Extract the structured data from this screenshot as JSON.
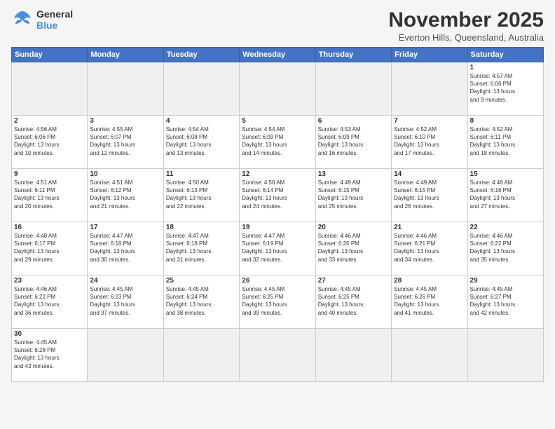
{
  "header": {
    "logo_general": "General",
    "logo_blue": "Blue",
    "month_title": "November 2025",
    "subtitle": "Everton Hills, Queensland, Australia"
  },
  "weekdays": [
    "Sunday",
    "Monday",
    "Tuesday",
    "Wednesday",
    "Thursday",
    "Friday",
    "Saturday"
  ],
  "weeks": [
    [
      {
        "day": "",
        "info": ""
      },
      {
        "day": "",
        "info": ""
      },
      {
        "day": "",
        "info": ""
      },
      {
        "day": "",
        "info": ""
      },
      {
        "day": "",
        "info": ""
      },
      {
        "day": "",
        "info": ""
      },
      {
        "day": "1",
        "info": "Sunrise: 4:57 AM\nSunset: 6:06 PM\nDaylight: 13 hours\nand 9 minutes."
      }
    ],
    [
      {
        "day": "2",
        "info": "Sunrise: 4:56 AM\nSunset: 6:06 PM\nDaylight: 13 hours\nand 10 minutes."
      },
      {
        "day": "3",
        "info": "Sunrise: 4:55 AM\nSunset: 6:07 PM\nDaylight: 13 hours\nand 12 minutes."
      },
      {
        "day": "4",
        "info": "Sunrise: 4:54 AM\nSunset: 6:08 PM\nDaylight: 13 hours\nand 13 minutes."
      },
      {
        "day": "5",
        "info": "Sunrise: 4:54 AM\nSunset: 6:09 PM\nDaylight: 13 hours\nand 14 minutes."
      },
      {
        "day": "6",
        "info": "Sunrise: 4:53 AM\nSunset: 6:09 PM\nDaylight: 13 hours\nand 16 minutes."
      },
      {
        "day": "7",
        "info": "Sunrise: 4:52 AM\nSunset: 6:10 PM\nDaylight: 13 hours\nand 17 minutes."
      },
      {
        "day": "8",
        "info": "Sunrise: 4:52 AM\nSunset: 6:11 PM\nDaylight: 13 hours\nand 18 minutes."
      }
    ],
    [
      {
        "day": "9",
        "info": "Sunrise: 4:51 AM\nSunset: 6:11 PM\nDaylight: 13 hours\nand 20 minutes."
      },
      {
        "day": "10",
        "info": "Sunrise: 4:51 AM\nSunset: 6:12 PM\nDaylight: 13 hours\nand 21 minutes."
      },
      {
        "day": "11",
        "info": "Sunrise: 4:50 AM\nSunset: 6:13 PM\nDaylight: 13 hours\nand 22 minutes."
      },
      {
        "day": "12",
        "info": "Sunrise: 4:50 AM\nSunset: 6:14 PM\nDaylight: 13 hours\nand 24 minutes."
      },
      {
        "day": "13",
        "info": "Sunrise: 4:49 AM\nSunset: 6:15 PM\nDaylight: 13 hours\nand 25 minutes."
      },
      {
        "day": "14",
        "info": "Sunrise: 4:49 AM\nSunset: 6:15 PM\nDaylight: 13 hours\nand 26 minutes."
      },
      {
        "day": "15",
        "info": "Sunrise: 4:48 AM\nSunset: 6:16 PM\nDaylight: 13 hours\nand 27 minutes."
      }
    ],
    [
      {
        "day": "16",
        "info": "Sunrise: 4:48 AM\nSunset: 6:17 PM\nDaylight: 13 hours\nand 29 minutes."
      },
      {
        "day": "17",
        "info": "Sunrise: 4:47 AM\nSunset: 6:18 PM\nDaylight: 13 hours\nand 30 minutes."
      },
      {
        "day": "18",
        "info": "Sunrise: 4:47 AM\nSunset: 6:18 PM\nDaylight: 13 hours\nand 31 minutes."
      },
      {
        "day": "19",
        "info": "Sunrise: 4:47 AM\nSunset: 6:19 PM\nDaylight: 13 hours\nand 32 minutes."
      },
      {
        "day": "20",
        "info": "Sunrise: 4:46 AM\nSunset: 6:20 PM\nDaylight: 13 hours\nand 33 minutes."
      },
      {
        "day": "21",
        "info": "Sunrise: 4:46 AM\nSunset: 6:21 PM\nDaylight: 13 hours\nand 34 minutes."
      },
      {
        "day": "22",
        "info": "Sunrise: 4:46 AM\nSunset: 6:22 PM\nDaylight: 13 hours\nand 35 minutes."
      }
    ],
    [
      {
        "day": "23",
        "info": "Sunrise: 4:46 AM\nSunset: 6:22 PM\nDaylight: 13 hours\nand 36 minutes."
      },
      {
        "day": "24",
        "info": "Sunrise: 4:45 AM\nSunset: 6:23 PM\nDaylight: 13 hours\nand 37 minutes."
      },
      {
        "day": "25",
        "info": "Sunrise: 4:45 AM\nSunset: 6:24 PM\nDaylight: 13 hours\nand 38 minutes."
      },
      {
        "day": "26",
        "info": "Sunrise: 4:45 AM\nSunset: 6:25 PM\nDaylight: 13 hours\nand 39 minutes."
      },
      {
        "day": "27",
        "info": "Sunrise: 4:45 AM\nSunset: 6:25 PM\nDaylight: 13 hours\nand 40 minutes."
      },
      {
        "day": "28",
        "info": "Sunrise: 4:45 AM\nSunset: 6:26 PM\nDaylight: 13 hours\nand 41 minutes."
      },
      {
        "day": "29",
        "info": "Sunrise: 4:45 AM\nSunset: 6:27 PM\nDaylight: 13 hours\nand 42 minutes."
      }
    ],
    [
      {
        "day": "30",
        "info": "Sunrise: 4:45 AM\nSunset: 6:28 PM\nDaylight: 13 hours\nand 43 minutes."
      },
      {
        "day": "",
        "info": ""
      },
      {
        "day": "",
        "info": ""
      },
      {
        "day": "",
        "info": ""
      },
      {
        "day": "",
        "info": ""
      },
      {
        "day": "",
        "info": ""
      },
      {
        "day": "",
        "info": ""
      }
    ]
  ]
}
